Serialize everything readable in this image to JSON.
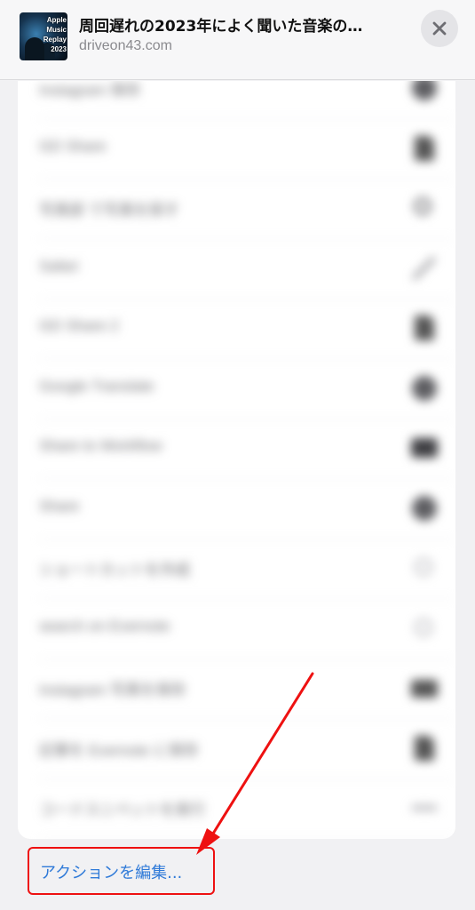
{
  "header": {
    "thumbnail_text": "Apple Music\nReplay\n2023",
    "title": "周回遅れの2023年によく聞いた音楽の…",
    "domain": "driveon43.com",
    "close_icon": "xmark-icon"
  },
  "action_rows": [
    {
      "label": "Instagram 保存",
      "icon": "circle-fill-icon"
    },
    {
      "label": "GD Share",
      "icon": "doc-fill-icon"
    },
    {
      "label": "写真部 で写真を探す",
      "icon": "magnifier-icon"
    },
    {
      "label": "Safari",
      "icon": "pencil-icon"
    },
    {
      "label": "GD Share 2",
      "icon": "doc-fill-icon"
    },
    {
      "label": "Google Translate",
      "icon": "circle-fill-icon"
    },
    {
      "label": "Share to Workflow",
      "icon": "square-fill-icon"
    },
    {
      "label": "Share",
      "icon": "circle-fill-icon"
    },
    {
      "label": "ショートカットを作成",
      "icon": "magnifier-light-icon"
    },
    {
      "label": "search on Evernote",
      "icon": "magnifier-light-icon"
    },
    {
      "label": "Instagram 写真を保存",
      "icon": "folder-fill-icon"
    },
    {
      "label": "記事を Evernote に保存",
      "icon": "doc-fill-icon"
    },
    {
      "label": "コードスニペットを実行",
      "icon": "ellipsis-icon"
    }
  ],
  "edit_actions": {
    "label": "アクションを編集..."
  },
  "colors": {
    "link": "#2f7ad8",
    "highlight": "#ee1111"
  }
}
